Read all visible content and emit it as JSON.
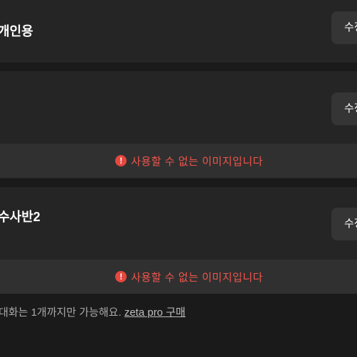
{
  "cards": [
    {
      "title": "개인용",
      "edit_label": "수정"
    },
    {
      "title": "",
      "edit_label": "수정",
      "error": "사용할 수 없는 이미지입니다"
    },
    {
      "title": "수사반2",
      "edit_label": "수정",
      "error": "사용할 수 없는 이미지입니다"
    }
  ],
  "icons": {
    "warning": "exclamation-circle-icon"
  },
  "colors": {
    "error": "#f0564c",
    "error_icon": "#e5483f"
  },
  "footer": {
    "text": "대화는 1개까지만 가능해요.",
    "link": "zeta pro 구매"
  }
}
